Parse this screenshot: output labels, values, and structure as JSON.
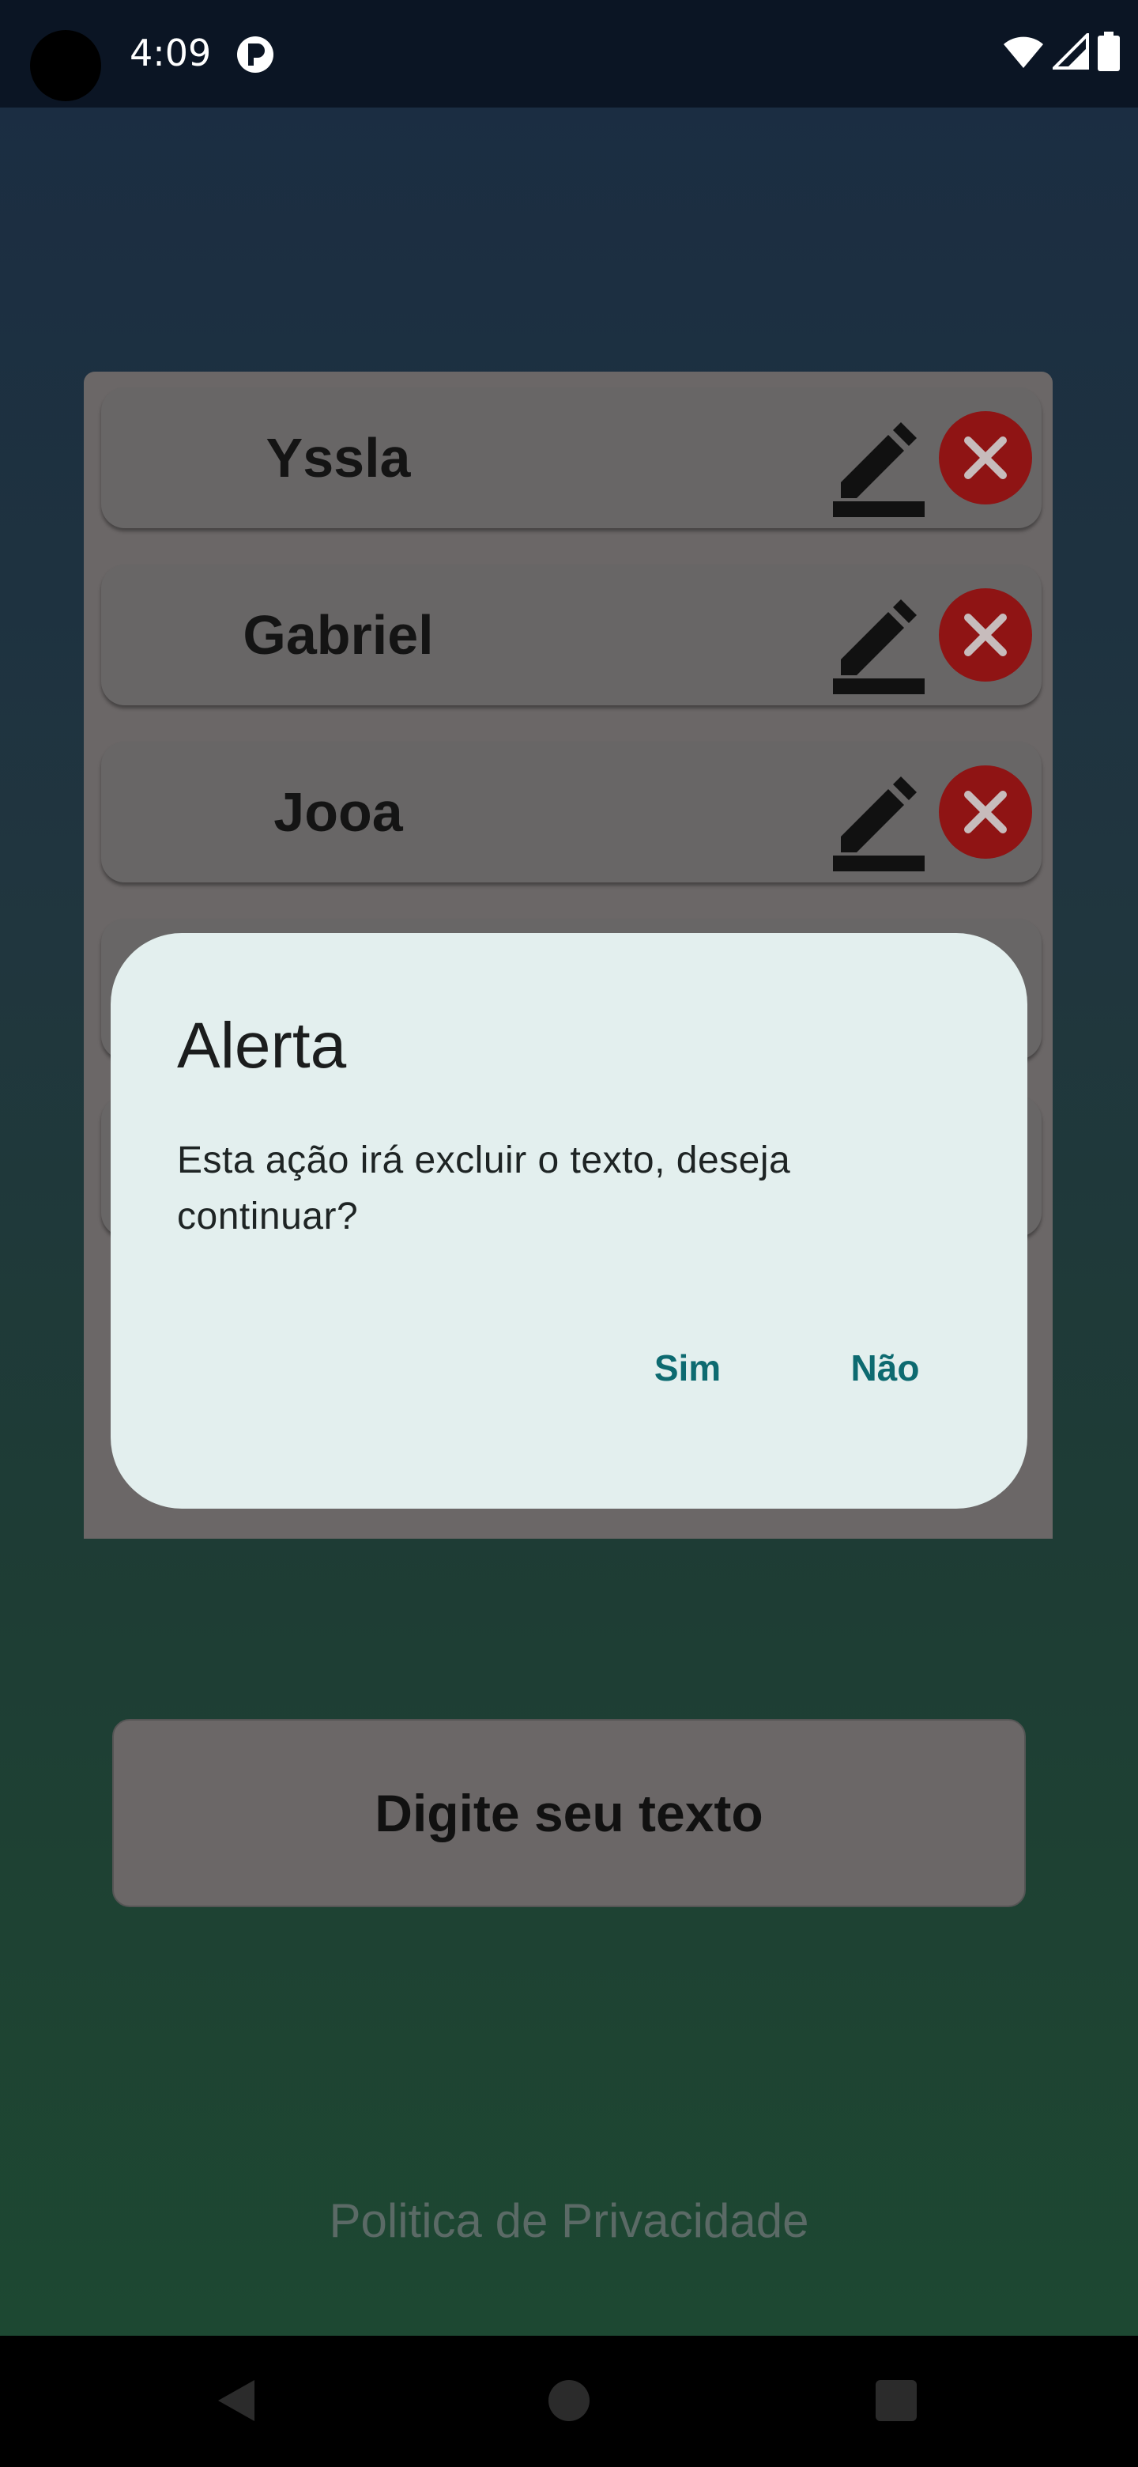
{
  "status_bar": {
    "time": "4:09"
  },
  "list": {
    "items": [
      {
        "name": "Yssla"
      },
      {
        "name": "Gabriel"
      },
      {
        "name": "Jooa"
      }
    ]
  },
  "dialog": {
    "title": "Alerta",
    "message": "Esta ação irá excluir o texto, deseja continuar?",
    "confirm_label": "Sim",
    "cancel_label": "Não"
  },
  "input": {
    "placeholder": "Digite seu texto"
  },
  "footer": {
    "privacy_link": "Politica de Privacidade"
  },
  "colors": {
    "accent": "#0d6a70",
    "delete": "#8f1414",
    "dialog_bg": "#e3efee"
  },
  "icons": {
    "edit": "pencil-edit-icon",
    "delete": "close-x-icon",
    "wifi": "wifi-icon",
    "signal": "cell-signal-icon",
    "battery": "battery-icon"
  }
}
